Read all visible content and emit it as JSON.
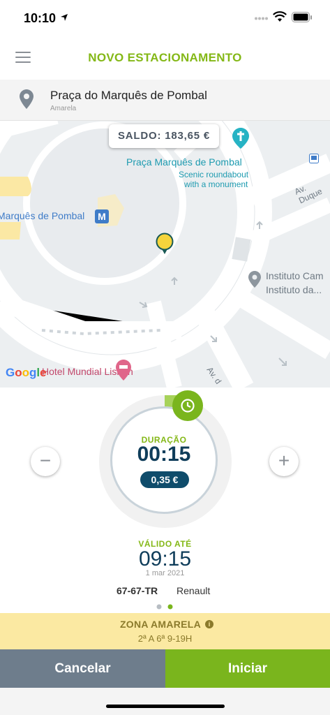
{
  "status_bar": {
    "time": "10:10"
  },
  "header": {
    "title": "NOVO ESTACIONAMENTO",
    "menu_icon": "hamburger-menu-icon"
  },
  "location": {
    "name": "Praça do Marquês de Pombal",
    "zone": "Amarela",
    "icon": "map-pin-icon"
  },
  "map": {
    "balance": "SALDO: 183,65 €",
    "labels": {
      "square": "Praça Marquês de Pombal",
      "desc_line1": "Scenic roundabout",
      "desc_line2": "with a monument",
      "metro": "Marquês de Pombal",
      "metro_badge": "M",
      "institute_line1": "Instituto Cam",
      "institute_line2": "Instituto da...",
      "street_duque": "Av. Duque",
      "street_av": "Av. d",
      "hotel": "Hotel Mundial Lisbon",
      "google": "Google"
    }
  },
  "timer": {
    "duration_label": "DURAÇÃO",
    "duration": "00:15",
    "price": "0,35 €",
    "minus": "−",
    "plus": "+",
    "valid_label": "VÁLIDO ATÉ",
    "valid_time": "09:15",
    "valid_date": "1 mar 2021"
  },
  "vehicle": {
    "plate": "67-67-TR",
    "brand": "Renault"
  },
  "zone": {
    "title": "ZONA AMARELA",
    "info": "i",
    "hours": "2ª A 6ª 9-19H"
  },
  "actions": {
    "cancel": "Cancelar",
    "start": "Iniciar"
  },
  "colors": {
    "brand_green": "#7ab51d",
    "title_green": "#84b817",
    "navy": "#0f3d5a",
    "cancel_gray": "#6e7d8c",
    "zone_yellow": "#fbe9a2"
  }
}
